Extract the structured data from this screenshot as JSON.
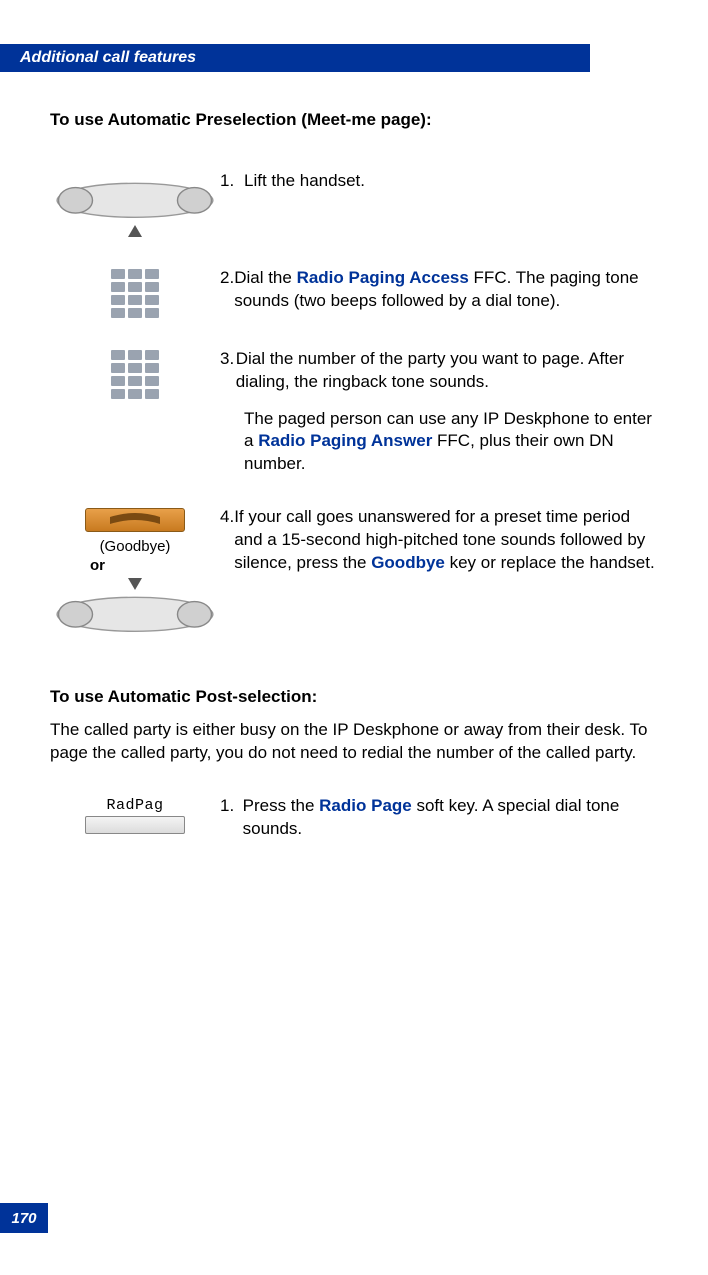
{
  "header": {
    "title": "Additional call features"
  },
  "section1": {
    "title": "To use Automatic Preselection (Meet-me page):",
    "steps": {
      "s1": {
        "num": "1.",
        "text": "Lift the handset."
      },
      "s2": {
        "num": "2.",
        "lead": "Dial the ",
        "link": "Radio Paging Access",
        "tail": " FFC. The paging tone sounds (two beeps followed by a dial tone)."
      },
      "s3": {
        "num": "3.",
        "text": "Dial the number of the party you want to page. After dialing, the ringback tone sounds.",
        "p2_lead": "The paged person can use any IP Deskphone to enter a ",
        "p2_link": "Radio Paging Answer",
        "p2_tail": " FFC, plus their own DN number."
      },
      "s4": {
        "num": "4.",
        "lead": "If your call goes unanswered for a preset time period and a 15-second high-pitched tone sounds followed by silence, press the ",
        "link": "Goodbye",
        "tail": " key or replace the handset."
      }
    },
    "goodbye_label": "(Goodbye)",
    "or_label": "or"
  },
  "section2": {
    "title": "To use Automatic Post-selection:",
    "intro": "The called party is either busy on the IP Deskphone or away from their desk. To page the called party, you do not need to redial the number of the called party.",
    "steps": {
      "s1": {
        "num": "1.",
        "lead": "Press the ",
        "link": "Radio Page",
        "tail": " soft key. A special dial tone sounds."
      }
    },
    "softkey_label": "RadPag"
  },
  "page_number": "170"
}
